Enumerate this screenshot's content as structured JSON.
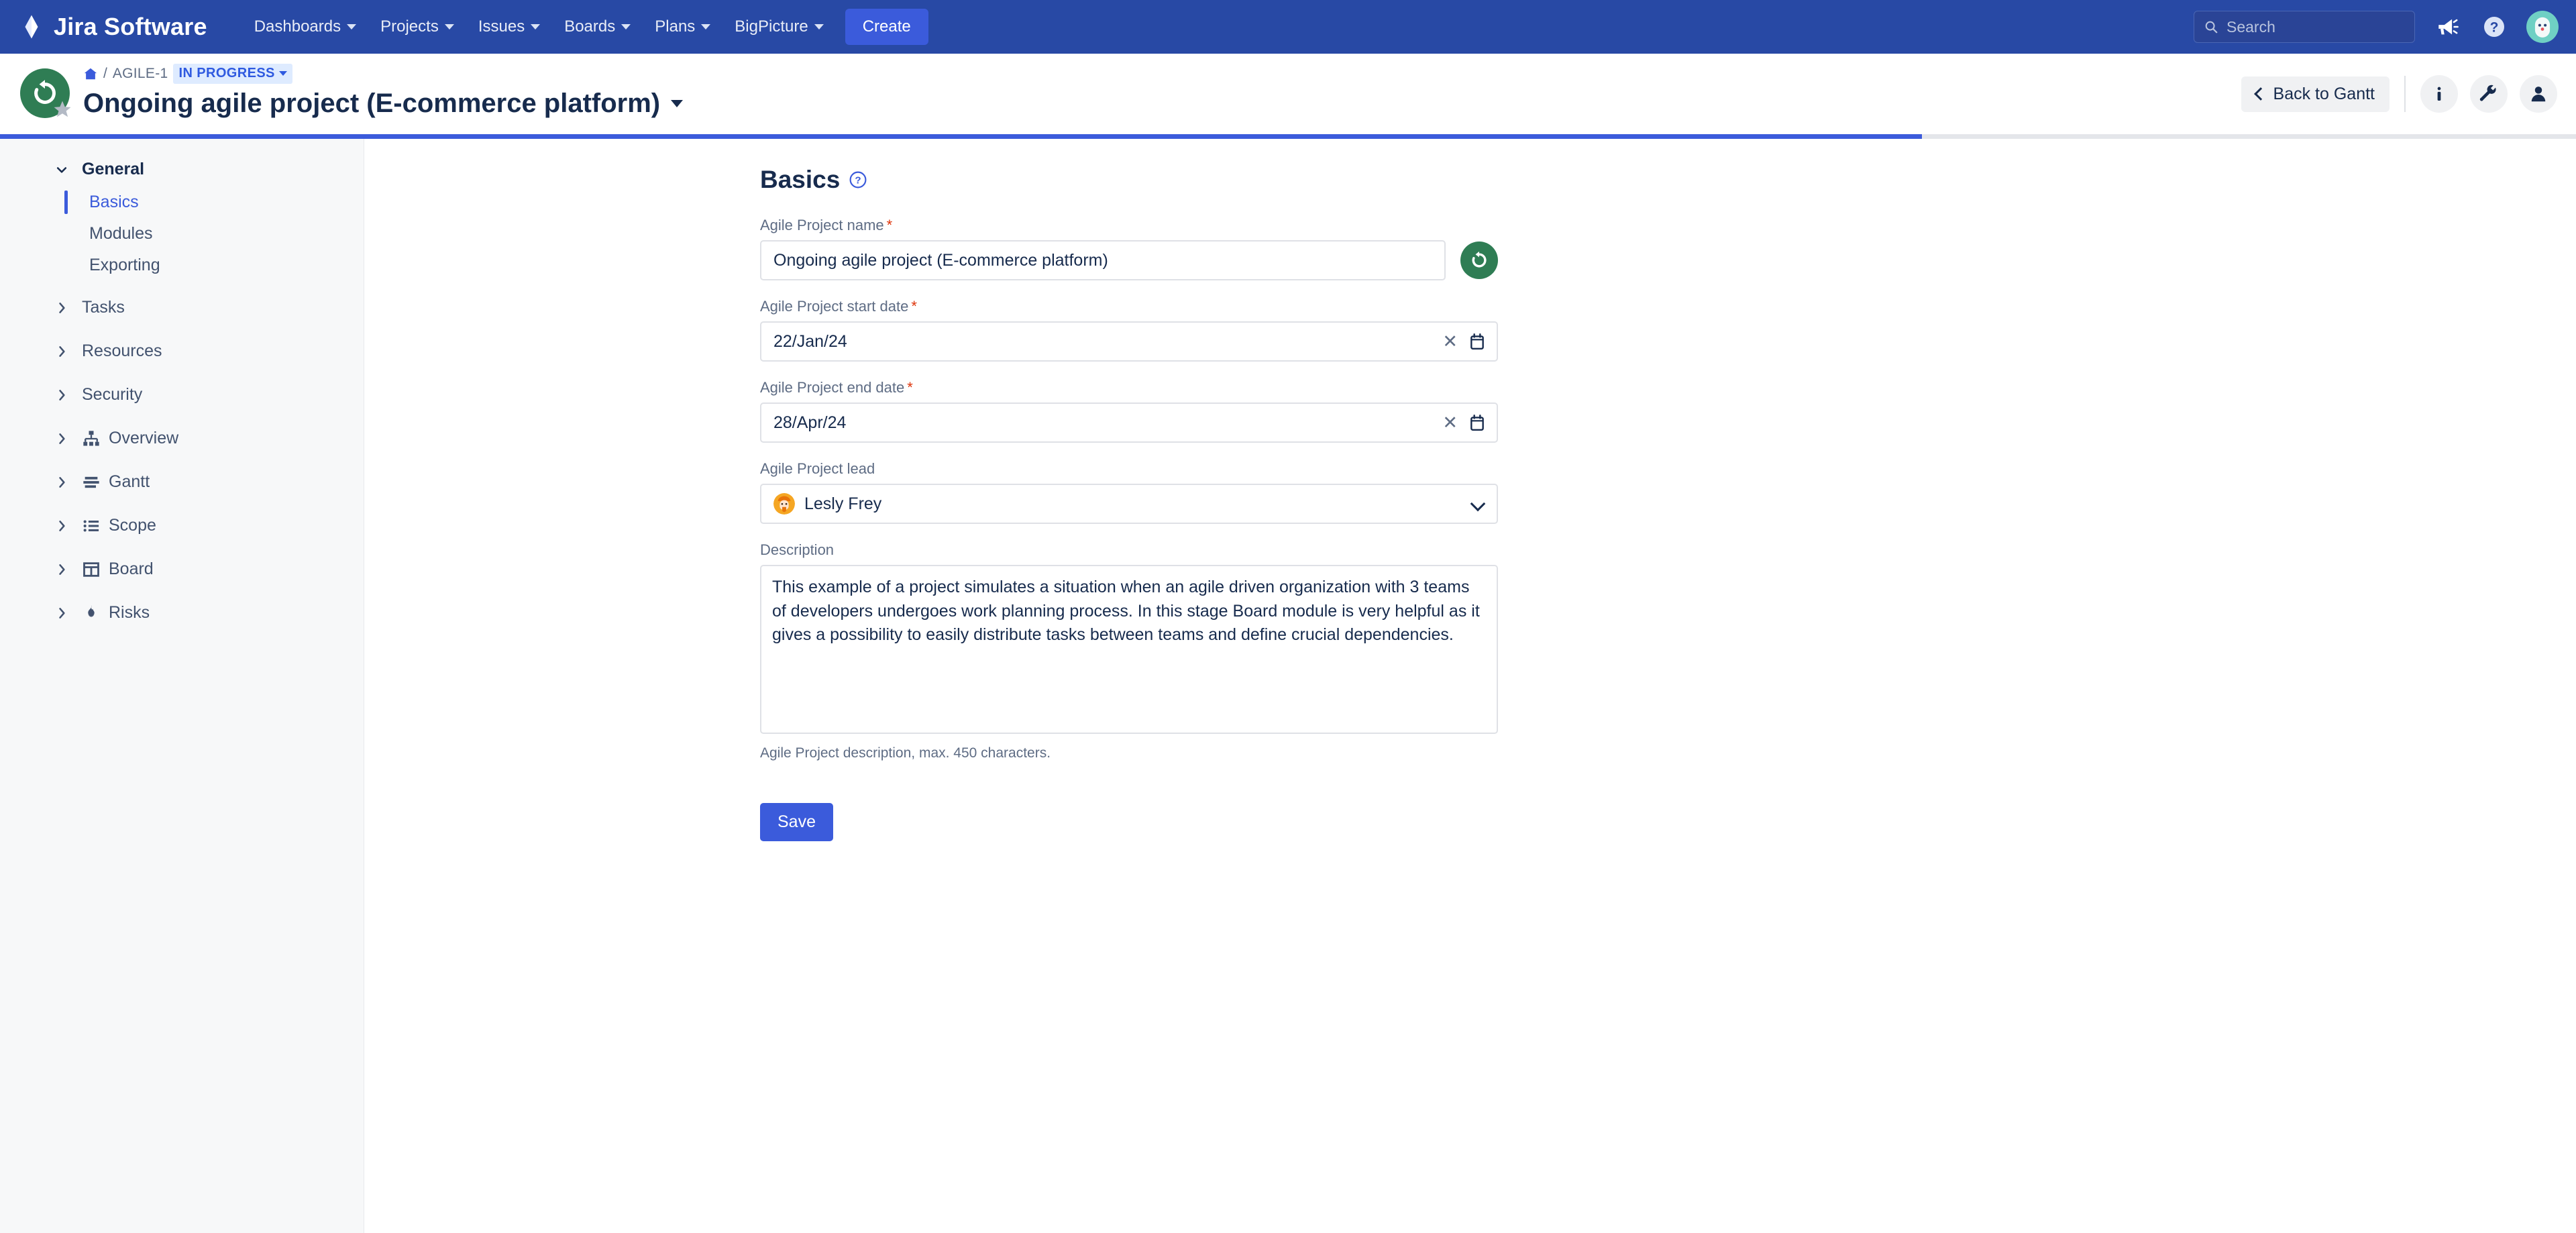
{
  "topnav": {
    "brand": "Jira Software",
    "brand_logo_icon": "jira-diamond-logo",
    "items": [
      {
        "label": "Dashboards",
        "has_caret": true
      },
      {
        "label": "Projects",
        "has_caret": true
      },
      {
        "label": "Issues",
        "has_caret": true
      },
      {
        "label": "Boards",
        "has_caret": true
      },
      {
        "label": "Plans",
        "has_caret": true
      },
      {
        "label": "BigPicture",
        "has_caret": true
      }
    ],
    "create_label": "Create",
    "search_placeholder": "Search",
    "search_value": "",
    "search_icon": "search-icon",
    "announcement_icon": "megaphone-icon",
    "help_icon": "help-circle-icon",
    "avatar_icon": "user-avatar",
    "bar_color": "#2849a5",
    "create_color": "#3b5bdb"
  },
  "project_header": {
    "avatar_icon": "rotate-arrow-icon",
    "avatar_color": "#2f7d54",
    "star_icon": "star-icon",
    "breadcrumb": {
      "home_icon": "home-icon",
      "separator": "/",
      "key": "AGILE-1",
      "status": "IN PROGRESS",
      "status_caret_icon": "chevron-down-icon"
    },
    "title": "Ongoing agile project (E-commerce platform)",
    "title_caret_icon": "chevron-down-icon",
    "back_button": {
      "label": "Back to Gantt",
      "icon": "chevron-left-icon"
    },
    "actions": [
      {
        "name": "info-button",
        "icon": "info-icon"
      },
      {
        "name": "settings-button",
        "icon": "wrench-icon"
      },
      {
        "name": "people-button",
        "icon": "person-icon"
      }
    ],
    "progress_percent": 74.6,
    "progress_color": "#3b5bdb"
  },
  "sidebar": {
    "groups": [
      {
        "label": "General",
        "expanded": true,
        "twisty_icon": "chevron-down-icon",
        "icon": null,
        "children": [
          {
            "label": "Basics",
            "active": true
          },
          {
            "label": "Modules",
            "active": false
          },
          {
            "label": "Exporting",
            "active": false
          }
        ]
      },
      {
        "label": "Tasks",
        "expanded": false,
        "twisty_icon": "chevron-right-icon",
        "icon": null,
        "children": []
      },
      {
        "label": "Resources",
        "expanded": false,
        "twisty_icon": "chevron-right-icon",
        "icon": null,
        "children": []
      },
      {
        "label": "Security",
        "expanded": false,
        "twisty_icon": "chevron-right-icon",
        "icon": null,
        "children": []
      },
      {
        "label": "Overview",
        "expanded": false,
        "twisty_icon": "chevron-right-icon",
        "icon": "org-chart-icon",
        "children": []
      },
      {
        "label": "Gantt",
        "expanded": false,
        "twisty_icon": "chevron-right-icon",
        "icon": "gantt-bars-icon",
        "children": []
      },
      {
        "label": "Scope",
        "expanded": false,
        "twisty_icon": "chevron-right-icon",
        "icon": "list-icon",
        "children": []
      },
      {
        "label": "Board",
        "expanded": false,
        "twisty_icon": "chevron-right-icon",
        "icon": "board-columns-icon",
        "children": []
      },
      {
        "label": "Risks",
        "expanded": false,
        "twisty_icon": "chevron-right-icon",
        "icon": "flame-icon",
        "children": []
      }
    ]
  },
  "main": {
    "page_title": "Basics",
    "help_icon": "question-circle-icon",
    "fields": {
      "name": {
        "label": "Agile Project name",
        "required": true,
        "value": "Ongoing agile project (E-commerce platform)",
        "placeholder": "",
        "revert_icon": "revert-arrow-icon",
        "revert_color": "#2f7d54"
      },
      "start_date": {
        "label": "Agile Project start date",
        "required": true,
        "value": "22/Jan/24",
        "placeholder": "",
        "clear_icon": "close-icon",
        "calendar_icon": "calendar-icon"
      },
      "end_date": {
        "label": "Agile Project end date",
        "required": true,
        "value": "28/Apr/24",
        "placeholder": "",
        "clear_icon": "close-icon",
        "calendar_icon": "calendar-icon"
      },
      "lead": {
        "label": "Agile Project lead",
        "required": false,
        "value": "Lesly Frey",
        "avatar_icon": "user-avatar",
        "avatar_color": "#f5a623",
        "caret_icon": "chevron-down-icon"
      },
      "description": {
        "label": "Description",
        "required": false,
        "value": "This example of a project simulates a situation when an agile driven organization with 3 teams of developers undergoes work planning process. In this stage Board module is very helpful as it gives a possibility to easily distribute tasks between teams and define crucial dependencies.",
        "placeholder": "",
        "hint": "Agile Project description, max. 450 characters."
      }
    },
    "save_label": "Save",
    "save_color": "#3b5bdb"
  }
}
